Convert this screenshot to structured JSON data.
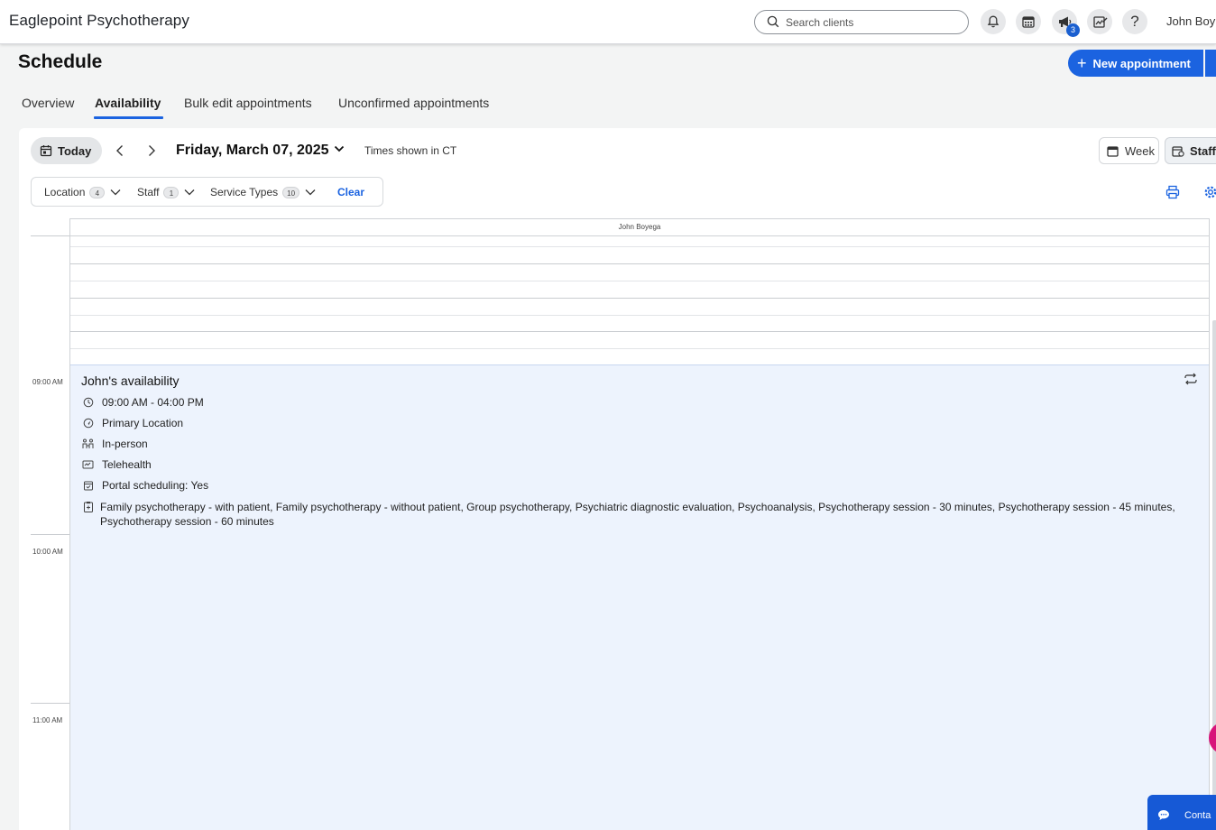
{
  "app": {
    "brand": "Eaglepoint Psychotherapy"
  },
  "header": {
    "search_placeholder": "Search clients",
    "notification_count": "3",
    "user_name": "John Boy"
  },
  "page": {
    "title": "Schedule",
    "new_appointment_label": "New appointment"
  },
  "tabs": [
    {
      "label": "Overview",
      "active": false
    },
    {
      "label": "Availability",
      "active": true
    },
    {
      "label": "Bulk edit appointments",
      "active": false
    },
    {
      "label": "Unconfirmed appointments",
      "active": false
    }
  ],
  "toolbar": {
    "today_label": "Today",
    "date_label": "Friday, March 07, 2025",
    "timezone_note": "Times shown in CT",
    "week_label": "Week",
    "staff_label": "Staff"
  },
  "filters": {
    "location": {
      "label": "Location",
      "count": "4"
    },
    "staff": {
      "label": "Staff",
      "count": "1"
    },
    "service_types": {
      "label": "Service Types",
      "count": "10"
    },
    "clear_label": "Clear"
  },
  "calendar": {
    "column_header": "John Boyega",
    "time_labels": [
      "09:00 AM",
      "10:00 AM",
      "11:00 AM"
    ]
  },
  "availability": {
    "title": "John's availability",
    "time_range": "09:00 AM - 04:00 PM",
    "location": "Primary Location",
    "in_person": "In-person",
    "telehealth": "Telehealth",
    "portal_scheduling": "Portal scheduling: Yes",
    "services": "Family psychotherapy - with patient, Family psychotherapy - without patient, Group psychotherapy, Psychiatric diagnostic evaluation, Psychoanalysis, Psychotherapy session - 30 minutes, Psychotherapy session - 45 minutes, Psychotherapy session - 60 minutes"
  },
  "footer": {
    "contact_label": "Conta"
  },
  "colors": {
    "accent": "#1b63e0",
    "availability_bg": "#edf3fd",
    "help_bubble": "#d8147a"
  }
}
